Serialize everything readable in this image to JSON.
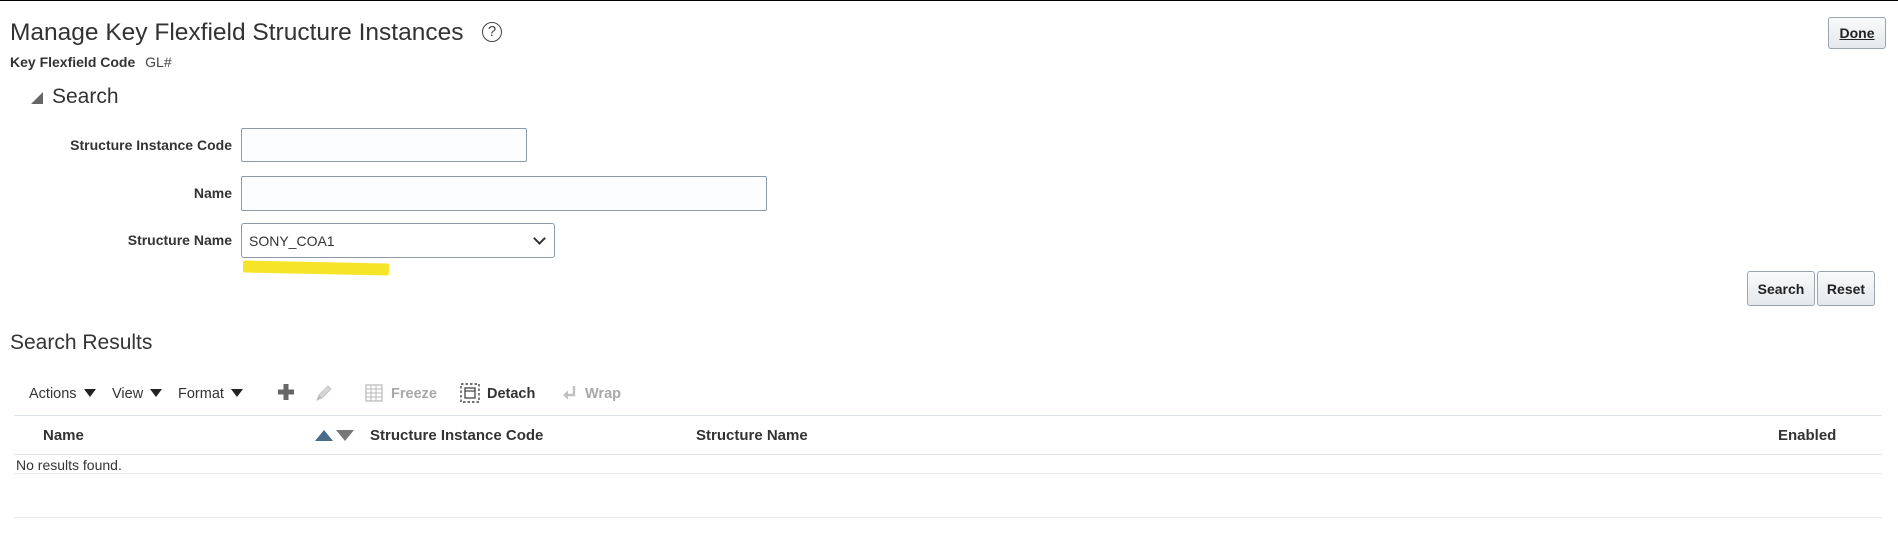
{
  "page": {
    "title": "Manage Key Flexfield Structure Instances",
    "help_symbol": "?",
    "key_flexfield_code_label": "Key Flexfield Code",
    "key_flexfield_code_value": "GL#",
    "done_label": "Done"
  },
  "search": {
    "header": "Search",
    "fields": {
      "structure_instance_code": {
        "label": "Structure Instance Code",
        "value": ""
      },
      "name": {
        "label": "Name",
        "value": ""
      },
      "structure_name": {
        "label": "Structure Name",
        "value": "SONY_COA1"
      }
    },
    "search_label": "Search",
    "reset_label": "Reset"
  },
  "results": {
    "header": "Search Results",
    "toolbar": {
      "actions": "Actions",
      "view": "View",
      "format": "Format",
      "freeze": "Freeze",
      "detach": "Detach",
      "wrap": "Wrap"
    },
    "columns": [
      "Name",
      "Structure Instance Code",
      "Structure Name",
      "Enabled"
    ],
    "empty_message": "No results found."
  },
  "colors": {
    "highlight": "#f5e31b",
    "disabled_text": "#a8a8a8",
    "sort_active": "#4a6a8a"
  },
  "icons": {
    "add": "plus-icon",
    "edit": "pencil-icon",
    "freeze": "freeze-grid-icon",
    "detach": "detach-icon",
    "wrap": "wrap-arrow-icon"
  }
}
